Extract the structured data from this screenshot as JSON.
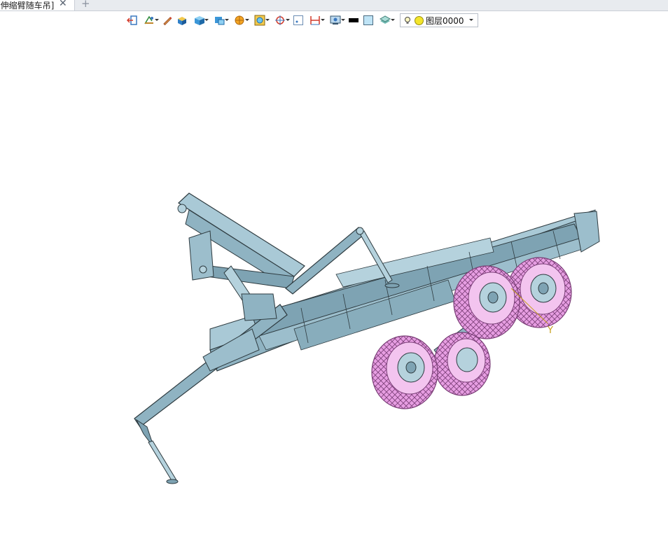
{
  "tab": {
    "title": "[伸缩臂随车吊]",
    "close_glyph": "✕",
    "add_glyph": "+"
  },
  "toolbar": {
    "icons": [
      "exit-icon",
      "sketch-icon",
      "pen-icon",
      "box-face-icon",
      "cube-icon",
      "part-icon",
      "sphere-icon",
      "frame-icon",
      "snap-target-icon",
      "grid-select-icon",
      "dimension-icon",
      "display-icon",
      "color-black-icon",
      "color-lightblue-icon",
      "layer-stack-icon"
    ],
    "layer": {
      "name": "图层0000"
    }
  },
  "viewport": {
    "axis_label": "Y",
    "colors": {
      "frame": "#8fb3c2",
      "frame_dark": "#2e3b40",
      "tire": "#e79ee2",
      "tire_dark": "#7a3f77"
    }
  }
}
